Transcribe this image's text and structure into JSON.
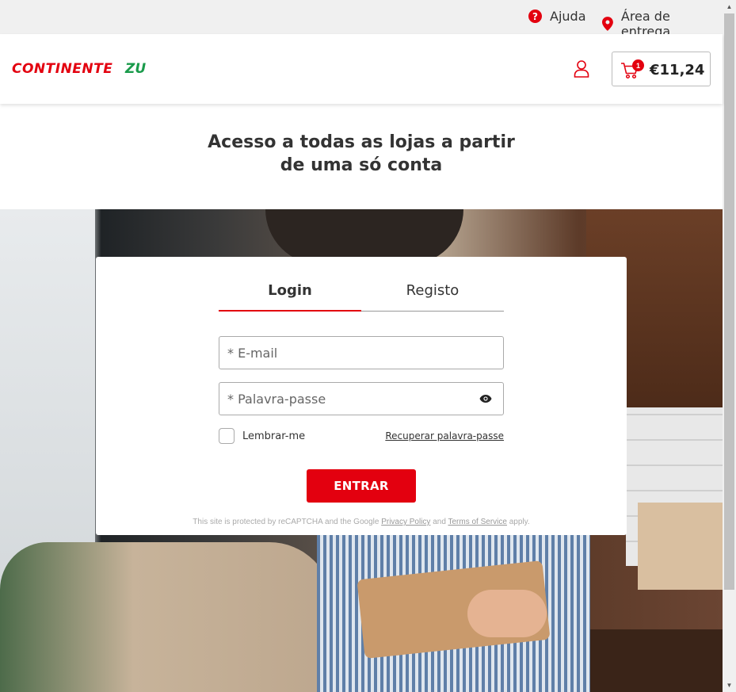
{
  "utility_bar": {
    "help_label": "Ajuda",
    "help_icon_glyph": "?",
    "delivery_label": "Área de entrega"
  },
  "header": {
    "logo_primary": "CONTINENTE",
    "logo_secondary": "ZU",
    "cart_count": "1",
    "cart_total": "€11,24"
  },
  "heading": {
    "line1": "Acesso a todas as lojas a partir",
    "line2": "de uma só conta"
  },
  "login_card": {
    "tabs": [
      {
        "label": "Login",
        "active": true
      },
      {
        "label": "Registo",
        "active": false
      }
    ],
    "email_placeholder": "* E-mail",
    "password_placeholder": "* Palavra-passe",
    "remember_label": "Lembrar-me",
    "remember_checked": false,
    "recover_label": "Recuperar palavra-passe",
    "submit_label": "ENTRAR",
    "recaptcha": {
      "prefix": "This site is protected by reCAPTCHA and the Google ",
      "privacy_label": "Privacy Policy",
      "middle": " and ",
      "terms_label": "Terms of Service",
      "suffix": " apply."
    }
  },
  "colors": {
    "brand_red": "#e3000f",
    "brand_green": "#1a9b4b"
  },
  "icons": [
    "help-icon",
    "location-pin-icon",
    "user-icon",
    "cart-icon",
    "eye-icon"
  ]
}
